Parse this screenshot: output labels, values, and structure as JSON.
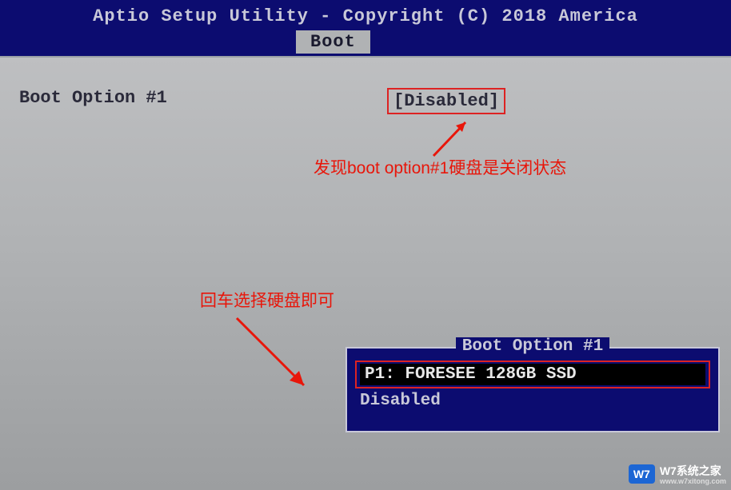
{
  "header": {
    "title": "Aptio Setup Utility - Copyright (C) 2018 America",
    "active_tab": "Boot"
  },
  "main": {
    "option_label": "Boot Option #1",
    "option_value": "[Disabled]"
  },
  "annotations": {
    "note1": "发现boot option#1硬盘是关闭状态",
    "note2": "回车选择硬盘即可"
  },
  "popup": {
    "title": "Boot Option #1",
    "selected": "P1: FORESEE 128GB SSD",
    "options": [
      "Disabled"
    ]
  },
  "watermark": {
    "badge": "W7",
    "name": "W7系统之家",
    "url": "www.w7xitong.com"
  }
}
